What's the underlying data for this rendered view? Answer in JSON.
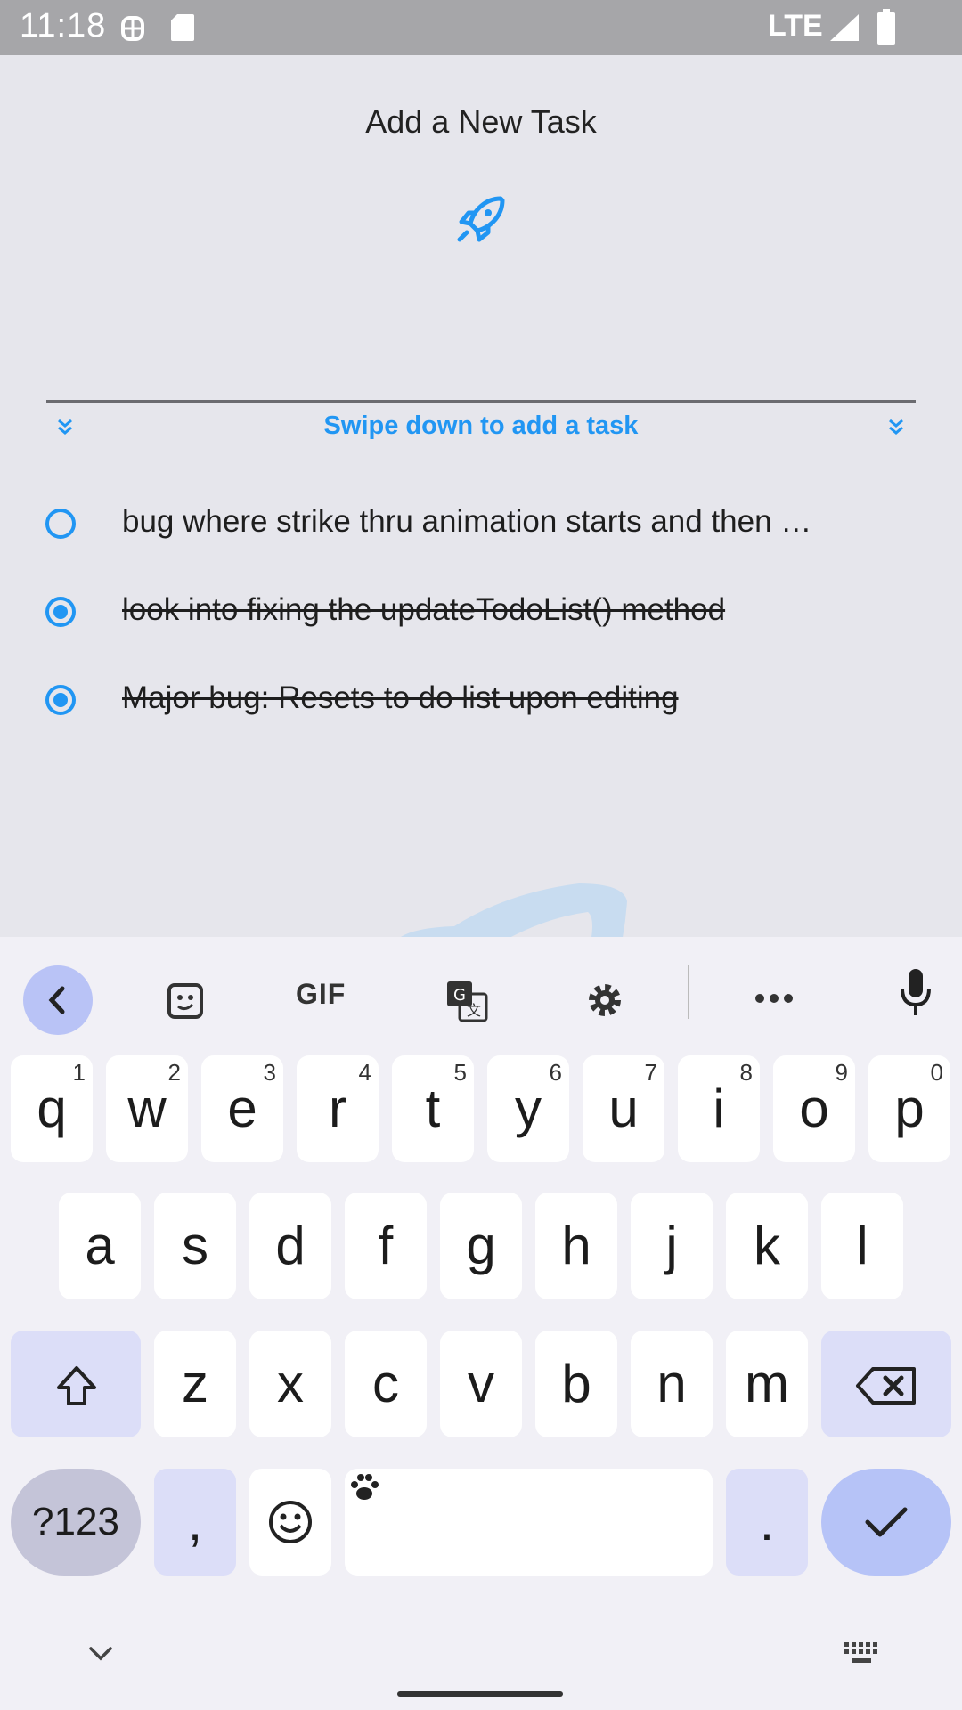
{
  "status_bar": {
    "time": "11:18",
    "network": "LTE"
  },
  "app": {
    "title": "Add a New Task",
    "rocket_icon": "rocket-icon",
    "swipe_hint": "Swipe down to add a task",
    "tasks": [
      {
        "text": "bug where strike thru animation starts and then …",
        "done": false
      },
      {
        "text": "look into fixing the updateTodoList() method",
        "done": true
      },
      {
        "text": "Major bug: Resets to do list upon editing",
        "done": true
      }
    ],
    "accent_color": "#2196f3"
  },
  "keyboard": {
    "toolbar": {
      "gif_label": "GIF"
    },
    "row1": [
      {
        "key": "q",
        "hint": "1"
      },
      {
        "key": "w",
        "hint": "2"
      },
      {
        "key": "e",
        "hint": "3"
      },
      {
        "key": "r",
        "hint": "4"
      },
      {
        "key": "t",
        "hint": "5"
      },
      {
        "key": "y",
        "hint": "6"
      },
      {
        "key": "u",
        "hint": "7"
      },
      {
        "key": "i",
        "hint": "8"
      },
      {
        "key": "o",
        "hint": "9"
      },
      {
        "key": "p",
        "hint": "0"
      }
    ],
    "row2": [
      "a",
      "s",
      "d",
      "f",
      "g",
      "h",
      "j",
      "k",
      "l"
    ],
    "row3": [
      "z",
      "x",
      "c",
      "v",
      "b",
      "n",
      "m"
    ],
    "symbols_label": "?123",
    "comma": ",",
    "period": "."
  }
}
